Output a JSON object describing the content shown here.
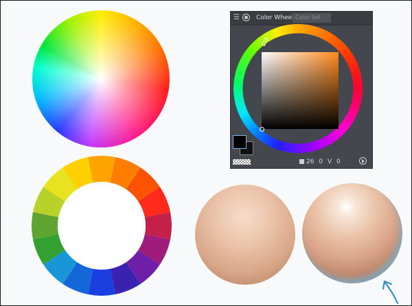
{
  "color_wheel_panel": {
    "title": "Color Wheel",
    "tab_color_set": "Color Set",
    "hsv_values": [
      "26",
      "0",
      "0"
    ],
    "main_color": "#000000",
    "sub_color": "#111111",
    "sv_square_hue_color": "#ff8a1e",
    "icons": [
      "menu-icon",
      "wheel-mode-icon",
      "toggle-mode-icon",
      "transparent-swatch-icon"
    ]
  },
  "segment_wheel": {
    "segments": [
      "#ffa300",
      "#ff7d00",
      "#ff5200",
      "#ff2a1a",
      "#c4204a",
      "#a01c7c",
      "#6e1ea8",
      "#3a22b0",
      "#1a3fe0",
      "#1566d8",
      "#1996d8",
      "#33a032",
      "#5ea430",
      "#b9d22a",
      "#e9e31f",
      "#ffd000"
    ]
  },
  "spheres": {
    "flat_skin": "#eac3a8",
    "shaded_skin": "#d9a488",
    "rim_light": "#78afcd"
  },
  "annotation_arrow_color": "#3a8fc0"
}
